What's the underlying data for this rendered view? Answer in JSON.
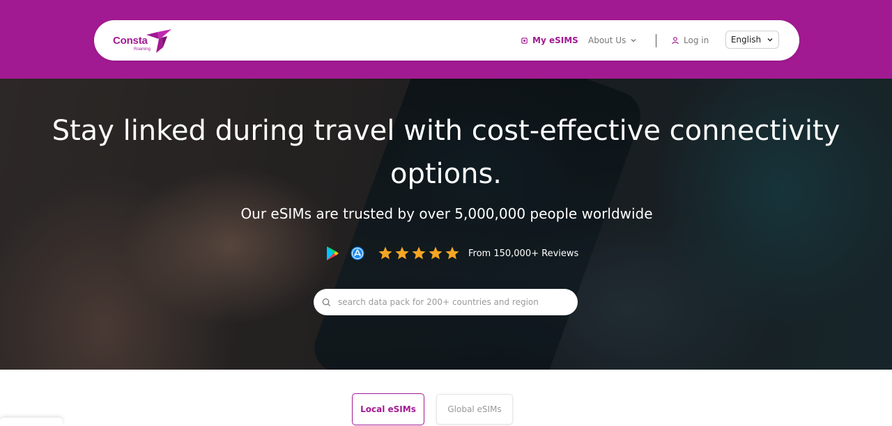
{
  "brand": {
    "name": "Consta",
    "tagline": "Roaming",
    "color": "#a21a92"
  },
  "nav": {
    "my_esims": "My eSIMS",
    "about_us": "About Us",
    "log_in": "Log in",
    "language": "English"
  },
  "hero": {
    "title": "Stay linked during travel with cost-effective connectivity options.",
    "subtitle": "Our eSIMs are trusted by over 5,000,000 people worldwide",
    "rating_stars": 5,
    "reviews_text": "From 150,000+ Reviews",
    "stores": [
      "google-play-icon",
      "app-store-icon"
    ]
  },
  "search": {
    "placeholder": "search data pack for 200+ countries and region",
    "value": ""
  },
  "tabs": {
    "local": "Local eSIMs",
    "global": "Global eSIMs",
    "active": "local"
  }
}
